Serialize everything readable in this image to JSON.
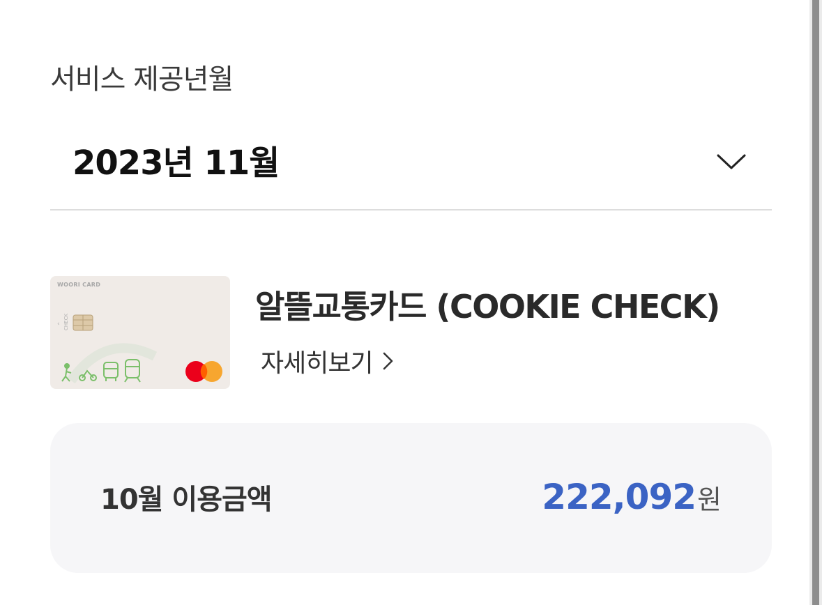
{
  "service_period": {
    "label": "서비스 제공년월",
    "selected_month": "2023년 11월"
  },
  "card": {
    "brand_text": "WOORI CARD",
    "name": "알뜰교통카드 (COOKIE CHECK)",
    "detail_link_label": "자세히보기"
  },
  "usage": {
    "label": "10월 이용금액",
    "amount": "222,092",
    "unit": "원"
  },
  "colors": {
    "amount": "#3b63c4",
    "card_background": "#f0ebe7",
    "mastercard_red": "#eb001b",
    "mastercard_orange": "#f79e1b",
    "card_illustration_green": "#7bbf6a"
  }
}
